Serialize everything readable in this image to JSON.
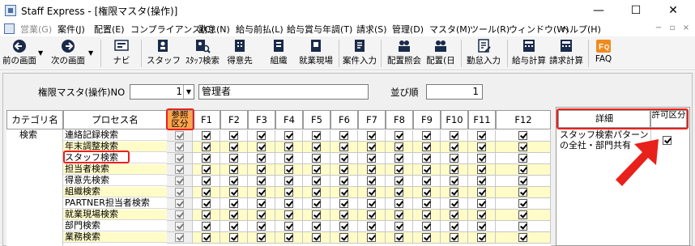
{
  "window": {
    "title": "Staff Express - [権限マスタ(操作)]",
    "minimize": "—",
    "maximize": "☐",
    "close": "✕"
  },
  "menubar": {
    "items": [
      {
        "label": "営業(G)",
        "disabled": true
      },
      {
        "label": "案件(J)",
        "disabled": false
      },
      {
        "label": "配置(E)",
        "disabled": false
      },
      {
        "label": "コンプライアンス(C)",
        "disabled": false
      },
      {
        "label": "勤怠(N)",
        "disabled": false
      },
      {
        "label": "給与前払(L)",
        "disabled": false
      },
      {
        "label": "給与賞与年調(T)",
        "disabled": false
      },
      {
        "label": "請求(S)",
        "disabled": false
      },
      {
        "label": "管理(D)",
        "disabled": false
      },
      {
        "label": "マスタ(M)",
        "disabled": false
      },
      {
        "label": "ツール(R)",
        "disabled": false
      },
      {
        "label": "ウィンドウ(W)",
        "disabled": false
      },
      {
        "label": "ヘルプ(H)",
        "disabled": false
      }
    ],
    "mdi_controls": [
      "−",
      "▫",
      "×"
    ]
  },
  "toolbar": {
    "buttons": [
      {
        "label": "前の画面",
        "icon": "back-arrow-icon"
      },
      {
        "label": "次の画面",
        "icon": "forward-arrow-icon"
      },
      {
        "label": "ナビ",
        "icon": "navi-icon"
      },
      {
        "label": "スタッフ",
        "icon": "staff-icon"
      },
      {
        "label": "ｽﾀｯﾌ検索",
        "icon": "staff-search-icon"
      },
      {
        "label": "得意先",
        "icon": "customer-icon"
      },
      {
        "label": "組織",
        "icon": "organization-icon"
      },
      {
        "label": "就業現場",
        "icon": "worksite-icon"
      },
      {
        "label": "案件入力",
        "icon": "project-entry-icon"
      },
      {
        "label": "配置照会",
        "icon": "assignment-inquiry-icon"
      },
      {
        "label": "配置(日",
        "icon": "assignment-day-icon"
      },
      {
        "label": "勤怠入力",
        "icon": "attendance-entry-icon"
      },
      {
        "label": "給与計算",
        "icon": "payroll-icon"
      },
      {
        "label": "請求計算",
        "icon": "billing-icon"
      },
      {
        "label": "FAQ",
        "icon": "faq-icon"
      }
    ]
  },
  "form": {
    "master_label": "権限マスタ(操作)NO",
    "master_no": "1",
    "master_name": "管理者",
    "order_label": "並び順",
    "order_value": "1"
  },
  "grid": {
    "headers": {
      "category": "カテゴリ名",
      "process": "プロセス名",
      "reference": "参照区分",
      "f_keys": [
        "F1",
        "F2",
        "F3",
        "F4",
        "F5",
        "F6",
        "F7",
        "F8",
        "F9",
        "F10",
        "F11",
        "F12"
      ]
    },
    "rows": [
      {
        "category": "検索",
        "process": "連絡記録検索"
      },
      {
        "category": "",
        "process": "年末調整検索"
      },
      {
        "category": "",
        "process": "スタッフ検索"
      },
      {
        "category": "",
        "process": "担当者検索"
      },
      {
        "category": "",
        "process": "得意先検索"
      },
      {
        "category": "",
        "process": "組織検索"
      },
      {
        "category": "",
        "process": "PARTNER担当者検索"
      },
      {
        "category": "",
        "process": "就業現場検索"
      },
      {
        "category": "",
        "process": "部門検索"
      },
      {
        "category": "",
        "process": "業務検索"
      }
    ]
  },
  "detail_panel": {
    "header_detail": "詳細",
    "header_permission": "許可区分",
    "description": "スタッフ検索パターンの全社・部門共有",
    "permission_checked": true
  },
  "colors": {
    "highlight_red": "#e8211a",
    "row_yellow": "#fffcc8",
    "reference_header_orange": "#ffa64d"
  }
}
